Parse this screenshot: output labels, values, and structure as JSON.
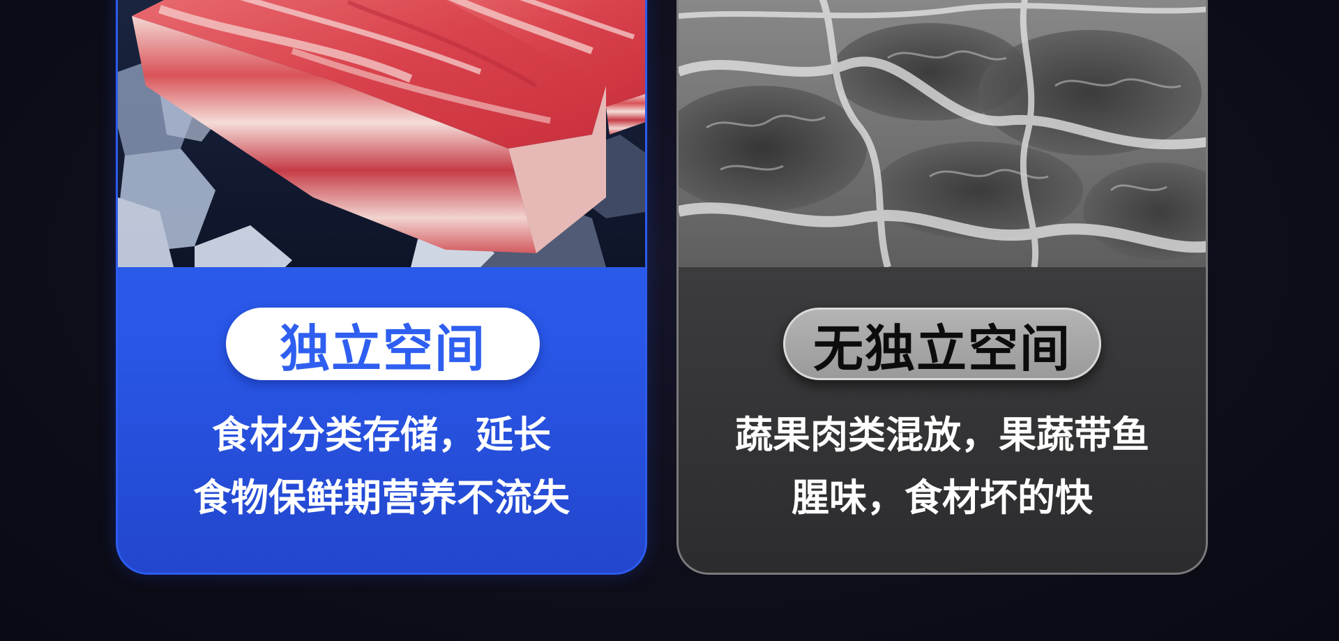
{
  "left_card": {
    "label": "独立空间",
    "description": [
      "食材分类存储，延长",
      "食物保鲜期营养不流失"
    ],
    "image": "fresh-pork-belly-on-ice",
    "accent_color": "#2f5ff0"
  },
  "right_card": {
    "label": "无独立空间",
    "description": [
      "蔬果肉类混放，果蔬带鱼",
      "腥味，食材坏的快"
    ],
    "image": "frosted-frozen-meat-grayscale",
    "accent_color": "#3a3a3c"
  }
}
